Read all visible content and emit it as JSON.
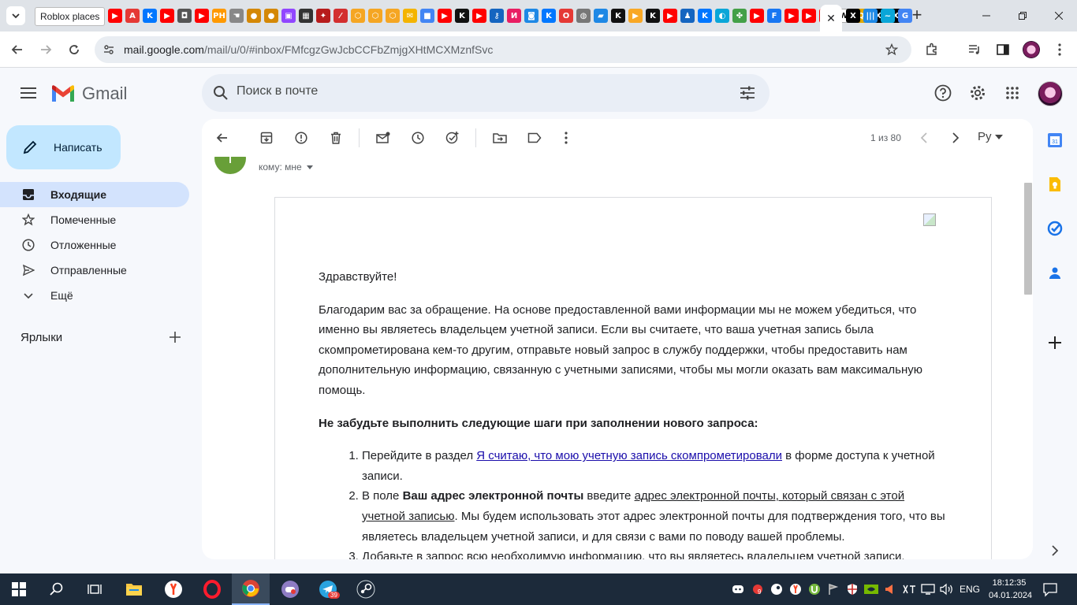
{
  "browser": {
    "tooltip": "Roblox places",
    "close_tab_glyph": "✕",
    "new_tab_glyph": "+",
    "tab_favicons": [
      {
        "icon": "youtube-icon",
        "color": "#ff0000",
        "glyph": "▶"
      },
      {
        "icon": "letter-a-icon",
        "color": "#e53935",
        "glyph": "A"
      },
      {
        "icon": "vk-icon",
        "color": "#0077ff",
        "glyph": "K"
      },
      {
        "icon": "youtube-icon",
        "color": "#ff0000",
        "glyph": "▶"
      },
      {
        "icon": "roblox-icon",
        "color": "#555555",
        "glyph": "◘"
      },
      {
        "icon": "youtube-icon",
        "color": "#ff0000",
        "glyph": "▶"
      },
      {
        "icon": "ph-icon",
        "color": "#ff9900",
        "glyph": "PH"
      },
      {
        "icon": "hand-icon",
        "color": "#888888",
        "glyph": "☚"
      },
      {
        "icon": "circle-icon",
        "color": "#d48806",
        "glyph": "●"
      },
      {
        "icon": "circle-icon",
        "color": "#d48806",
        "glyph": "●"
      },
      {
        "icon": "twitch-icon",
        "color": "#9146ff",
        "glyph": "▣"
      },
      {
        "icon": "grid-icon",
        "color": "#333333",
        "glyph": "▦"
      },
      {
        "icon": "game-icon",
        "color": "#b71c1c",
        "glyph": "✦"
      },
      {
        "icon": "red-icon",
        "color": "#d32f2f",
        "glyph": "⁄"
      },
      {
        "icon": "hexagon-icon",
        "color": "#f5a623",
        "glyph": "⬡"
      },
      {
        "icon": "hexagon-icon",
        "color": "#f5a623",
        "glyph": "⬡"
      },
      {
        "icon": "hexagon-icon",
        "color": "#f5a623",
        "glyph": "⬡"
      },
      {
        "icon": "mail-icon",
        "color": "#f4b400",
        "glyph": "✉"
      },
      {
        "icon": "cube-icon",
        "color": "#4285f4",
        "glyph": "■"
      },
      {
        "icon": "youtube-icon",
        "color": "#ff0000",
        "glyph": "▶"
      },
      {
        "icon": "kinopoisk-icon",
        "color": "#111111",
        "glyph": "K"
      },
      {
        "icon": "youtube-icon",
        "color": "#ff0000",
        "glyph": "▶"
      },
      {
        "icon": "key-icon",
        "color": "#1565c0",
        "glyph": "⚷"
      },
      {
        "icon": "letter-i-icon",
        "color": "#e91e63",
        "glyph": "И"
      },
      {
        "icon": "app-icon",
        "color": "#1e88e5",
        "glyph": "◙"
      },
      {
        "icon": "vk-icon",
        "color": "#0077ff",
        "glyph": "K"
      },
      {
        "icon": "circle-red-icon",
        "color": "#e53935",
        "glyph": "O"
      },
      {
        "icon": "globe-icon",
        "color": "#777777",
        "glyph": "◍"
      },
      {
        "icon": "chat-icon",
        "color": "#1e88e5",
        "glyph": "▰"
      },
      {
        "icon": "kinopoisk-icon",
        "color": "#111111",
        "glyph": "K"
      },
      {
        "icon": "play-yellow-icon",
        "color": "#f9a825",
        "glyph": "▶"
      },
      {
        "icon": "kinopoisk-icon",
        "color": "#111111",
        "glyph": "K"
      },
      {
        "icon": "youtube-icon",
        "color": "#ff0000",
        "glyph": "▶"
      },
      {
        "icon": "person-icon",
        "color": "#1565c0",
        "glyph": "♟"
      },
      {
        "icon": "vk-icon",
        "color": "#0077ff",
        "glyph": "K"
      },
      {
        "icon": "edge-icon",
        "color": "#0aa6d8",
        "glyph": "◐"
      },
      {
        "icon": "multi-icon",
        "color": "#43a047",
        "glyph": "✤"
      },
      {
        "icon": "youtube-icon",
        "color": "#ff0000",
        "glyph": "▶"
      },
      {
        "icon": "letter-f-icon",
        "color": "#1877f2",
        "glyph": "F"
      },
      {
        "icon": "youtube-icon",
        "color": "#ff0000",
        "glyph": "▶"
      },
      {
        "icon": "youtube-icon",
        "color": "#ff0000",
        "glyph": "▶"
      },
      {
        "icon": "youtube-icon",
        "color": "#ff0000",
        "glyph": "▶"
      },
      {
        "icon": "wikipedia-icon",
        "color": "#ffffff",
        "glyph": "W"
      },
      {
        "icon": "qwant-icon",
        "color": "#e0a800",
        "glyph": "Q"
      },
      {
        "icon": "x-icon",
        "color": "#000000",
        "glyph": "X"
      },
      {
        "icon": "x-icon",
        "color": "#000000",
        "glyph": "X"
      }
    ],
    "tab_favicons_right": [
      {
        "icon": "x-icon",
        "color": "#000000",
        "glyph": "X"
      },
      {
        "icon": "stripes-icon",
        "color": "#1e88e5",
        "glyph": "|||"
      },
      {
        "icon": "wave-icon",
        "color": "#0aa6d8",
        "glyph": "~"
      },
      {
        "icon": "google-icon",
        "color": "#4285f4",
        "glyph": "G"
      }
    ],
    "url_host": "mail.google.com",
    "url_path": "/mail/u/0/#inbox/FMfcgzGwJcbCCFbZmjgXHtMCXMznfSvc"
  },
  "gmail": {
    "logo_text": "Gmail",
    "search_placeholder": "Поиск в почте",
    "compose_label": "Написать",
    "nav": [
      {
        "label": "Входящие",
        "icon": "inbox-icon"
      },
      {
        "label": "Помеченные",
        "icon": "star-icon"
      },
      {
        "label": "Отложенные",
        "icon": "clock-icon"
      },
      {
        "label": "Отправленные",
        "icon": "send-icon"
      },
      {
        "label": "Ещё",
        "icon": "chevron-down-icon"
      }
    ],
    "labels_title": "Ярлыки",
    "page_count": "1 из 80",
    "language": "Ру",
    "sender_initial": "Т",
    "to_line": "кому: мне"
  },
  "email": {
    "greeting": "Здравствуйте!",
    "para1": "Благодарим вас за обращение. На основе предоставленной вами информации мы не можем убедиться, что именно вы являетесь владельцем учетной записи. Если вы считаете, что ваша учетная запись была скомпрометирована кем-то другим, отправьте новый запрос в службу поддержки, чтобы предоставить нам дополнительную информацию, связанную с учетными записями, чтобы мы могли оказать вам максимальную помощь.",
    "steps_heading": "Не забудьте выполнить следующие шаги при заполнении нового запроса:",
    "step1_pre": "Перейдите в раздел ",
    "step1_link": "Я считаю, что мою учетную запись скомпрометировали",
    "step1_post": " в форме доступа к учетной записи.",
    "step2_pre": "В поле ",
    "step2_bold": "Ваш адрес электронной почты",
    "step2_mid": " введите ",
    "step2_underline": "адрес электронной почты, который связан с этой учетной записью",
    "step2_post": ". Мы будем использовать этот адрес электронной почты для подтверждения того, что вы являетесь владельцем учетной записи, и для связи с вами по поводу вашей проблемы.",
    "step3": "Добавьте в запрос всю необходимую информацию, что вы являетесь владельцем учетной записи."
  },
  "taskbar": {
    "telegram_badge": "39",
    "tray_badge": "9",
    "language": "ENG",
    "time": "18:12:35",
    "date": "04.01.2024"
  }
}
